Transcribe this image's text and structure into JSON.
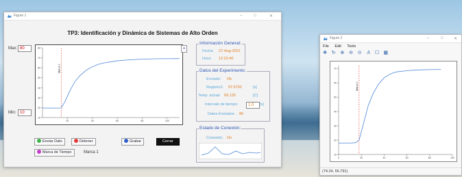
{
  "fig1": {
    "title": "Figure 1",
    "heading": "TP3: Identificación y Dinámica de Sistemas de Alto Orden",
    "max_label": "Max:",
    "max_value": "80",
    "min_label": "Min:",
    "min_value": "10",
    "plus_button": "+",
    "marker_label": "Marca 1",
    "info": {
      "title": "Información General:",
      "fecha_label": "Fecha:",
      "fecha_value": "27-Aug-2021",
      "hora_label": "Hora:",
      "hora_value": "12:22:40"
    },
    "experiment": {
      "title": "Datos del Experimento:",
      "enviado_label": "Enviado:",
      "enviado_value": "Ok",
      "registro_label": "Registro1:",
      "registro_value": "97.5752",
      "registro_unit": "[s]",
      "temp_label": "Temp. actual:",
      "temp_value": "69.125",
      "temp_unit": "[C]",
      "intervalo_label": "Intervalo de tiempo:",
      "intervalo_value": "1.0",
      "intervalo_unit": "[s]",
      "datos_label": "Datos Enviados:",
      "datos_value": "86"
    },
    "connection": {
      "title": "Estado de Conexión:",
      "conexion_label": "Conexión:",
      "conexion_value": "On"
    },
    "buttons": {
      "enviar": "Enviar Dato",
      "detener": "Detener",
      "grabar": "Grabar",
      "cerrar": "Cerrar",
      "marca": "Marca de Tiempo",
      "marca_text": "Marca 1"
    },
    "colors": {
      "curve": "#4a86d6",
      "marker": "#e0463c",
      "label_blue": "#2d55b3",
      "value_orange": "#e07a1c"
    }
  },
  "fig2": {
    "title": "Figure 2",
    "menu": [
      "File",
      "Edit",
      "Tools"
    ],
    "toolbar_icons": [
      "pan-icon",
      "rotate-icon",
      "zoom-in-icon",
      "zoom-out-icon",
      "zoom-reset-icon",
      "text-icon",
      "rectangle-icon",
      "grid-icon"
    ],
    "marker_label": "Marca 1",
    "status": "(74.24, 55.791)"
  },
  "chart_data": [
    {
      "type": "line",
      "title": "",
      "xlabel": "",
      "ylabel": "",
      "x_ticks": [
        "20",
        "40",
        "60",
        "80",
        "100"
      ],
      "y_ticks": [
        "10",
        "20",
        "30",
        "40",
        "50",
        "60",
        "70",
        "80"
      ],
      "ylim": [
        10,
        80
      ],
      "xlim": [
        0,
        110
      ],
      "marker_x": 15,
      "series": [
        {
          "x": [
            0,
            10,
            15,
            18,
            22,
            26,
            30,
            35,
            40,
            45,
            50,
            60,
            70,
            80,
            90,
            100,
            110
          ],
          "y": [
            19.5,
            19.5,
            19.6,
            26,
            37,
            46,
            52,
            57.5,
            61,
            63.5,
            65,
            67,
            68,
            68.6,
            69,
            69.1,
            69.2
          ]
        }
      ]
    },
    {
      "type": "line",
      "title": "",
      "xlabel": "",
      "ylabel": "",
      "x_ticks": [
        "0",
        "20",
        "40",
        "60",
        "80",
        "100"
      ],
      "y_ticks": [
        "10",
        "20",
        "30",
        "40",
        "50",
        "60",
        "70"
      ],
      "ylim": [
        10,
        72
      ],
      "xlim": [
        0,
        100
      ],
      "marker_x": 18,
      "series": [
        {
          "x": [
            0,
            10,
            15,
            18,
            22,
            26,
            30,
            35,
            40,
            45,
            50,
            60,
            70,
            80,
            90
          ],
          "y": [
            18,
            18,
            18.2,
            20,
            32,
            44,
            52,
            59,
            63.5,
            66,
            67.5,
            68.5,
            69,
            69.2,
            69.3
          ]
        }
      ]
    }
  ]
}
